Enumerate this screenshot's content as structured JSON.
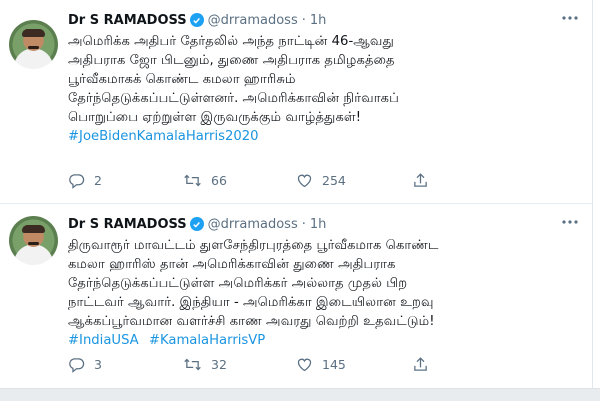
{
  "tweets": [
    {
      "author_name": "Dr S RAMADOSS",
      "handle": "@drramadoss",
      "separator": "·",
      "time": "1h",
      "lines": [
        "அமெரிக்க அதிபர் தேர்தலில் அந்த நாட்டின் 46-ஆவது",
        "அதிபராக ஜோ பிடனும், துணை அதிபராக தமிழகத்தை",
        "பூர்வீகமாகக் கொண்ட கமலா ஹாரிசும்",
        "தேர்ந்தெடுக்கப்பட்டுள்ளனர். அமெரிக்காவின் நிர்வாகப்",
        "பொறுப்பை ஏற்றுள்ள இருவருக்கும் வாழ்த்துகள்!"
      ],
      "hashtags": [
        "#JoeBidenKamalaHarris2020"
      ],
      "replies": "2",
      "retweets": "66",
      "likes": "254"
    },
    {
      "author_name": "Dr S RAMADOSS",
      "handle": "@drramadoss",
      "separator": "·",
      "time": "1h",
      "lines": [
        "திருவாரூர் மாவட்டம் துளசேந்திரபுரத்தை பூர்வீகமாக கொண்ட",
        "கமலா ஹாரிஸ் தான் அமெரிக்காவின் துணை அதிபராக",
        "தேர்ந்தெடுக்கப்பட்டுள்ள அமெரிக்கர் அல்லாத முதல் பிற",
        "நாட்டவர் ஆவார். இந்தியா - அமெரிக்கா இடையிலான உறவு",
        "ஆக்கப்பூர்வமான வளர்ச்சி காண அவரது வெற்றி உதவட்டும்!"
      ],
      "hashtags": [
        "#IndiaUSA",
        "#KamalaHarrisVP"
      ],
      "replies": "3",
      "retweets": "32",
      "likes": "145"
    }
  ],
  "colors": {
    "accent": "#1da1f2",
    "hashtag": "#1b95e0",
    "muted": "#5b7083",
    "text": "#0f1419"
  },
  "icons": [
    "verified-badge-icon",
    "more-icon",
    "reply-icon",
    "retweet-icon",
    "like-icon",
    "share-icon"
  ]
}
